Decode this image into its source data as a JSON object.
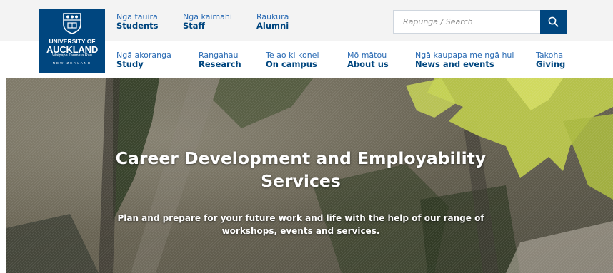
{
  "brand": {
    "line1": "UNIVERSITY OF",
    "line2": "AUCKLAND",
    "line3": "Waipapa Taumata Rau",
    "line4": "NEW ZEALAND"
  },
  "audience_nav": [
    {
      "maori": "Ngā tauira",
      "english": "Students"
    },
    {
      "maori": "Ngā kaimahi",
      "english": "Staff"
    },
    {
      "maori": "Raukura",
      "english": "Alumni"
    }
  ],
  "search": {
    "placeholder": "Rapunga / Search",
    "icon": "search-icon"
  },
  "main_nav": [
    {
      "maori": "Ngā akoranga",
      "english": "Study"
    },
    {
      "maori": "Rangahau",
      "english": "Research"
    },
    {
      "maori": "Te ao ki konei",
      "english": "On campus"
    },
    {
      "maori": "Mō mātou",
      "english": "About us"
    },
    {
      "maori": "Ngā kaupapa me ngā hui",
      "english": "News and events"
    },
    {
      "maori": "Takoha",
      "english": "Giving"
    }
  ],
  "hero": {
    "title": "Career Development and Employability Services",
    "subtitle": "Plan and prepare for your future work and life with the help of our range of workshops, events and services."
  },
  "colors": {
    "brand_navy": "#00467f",
    "link_blue": "#2a6bb4",
    "top_band": "#f3f3f3"
  }
}
